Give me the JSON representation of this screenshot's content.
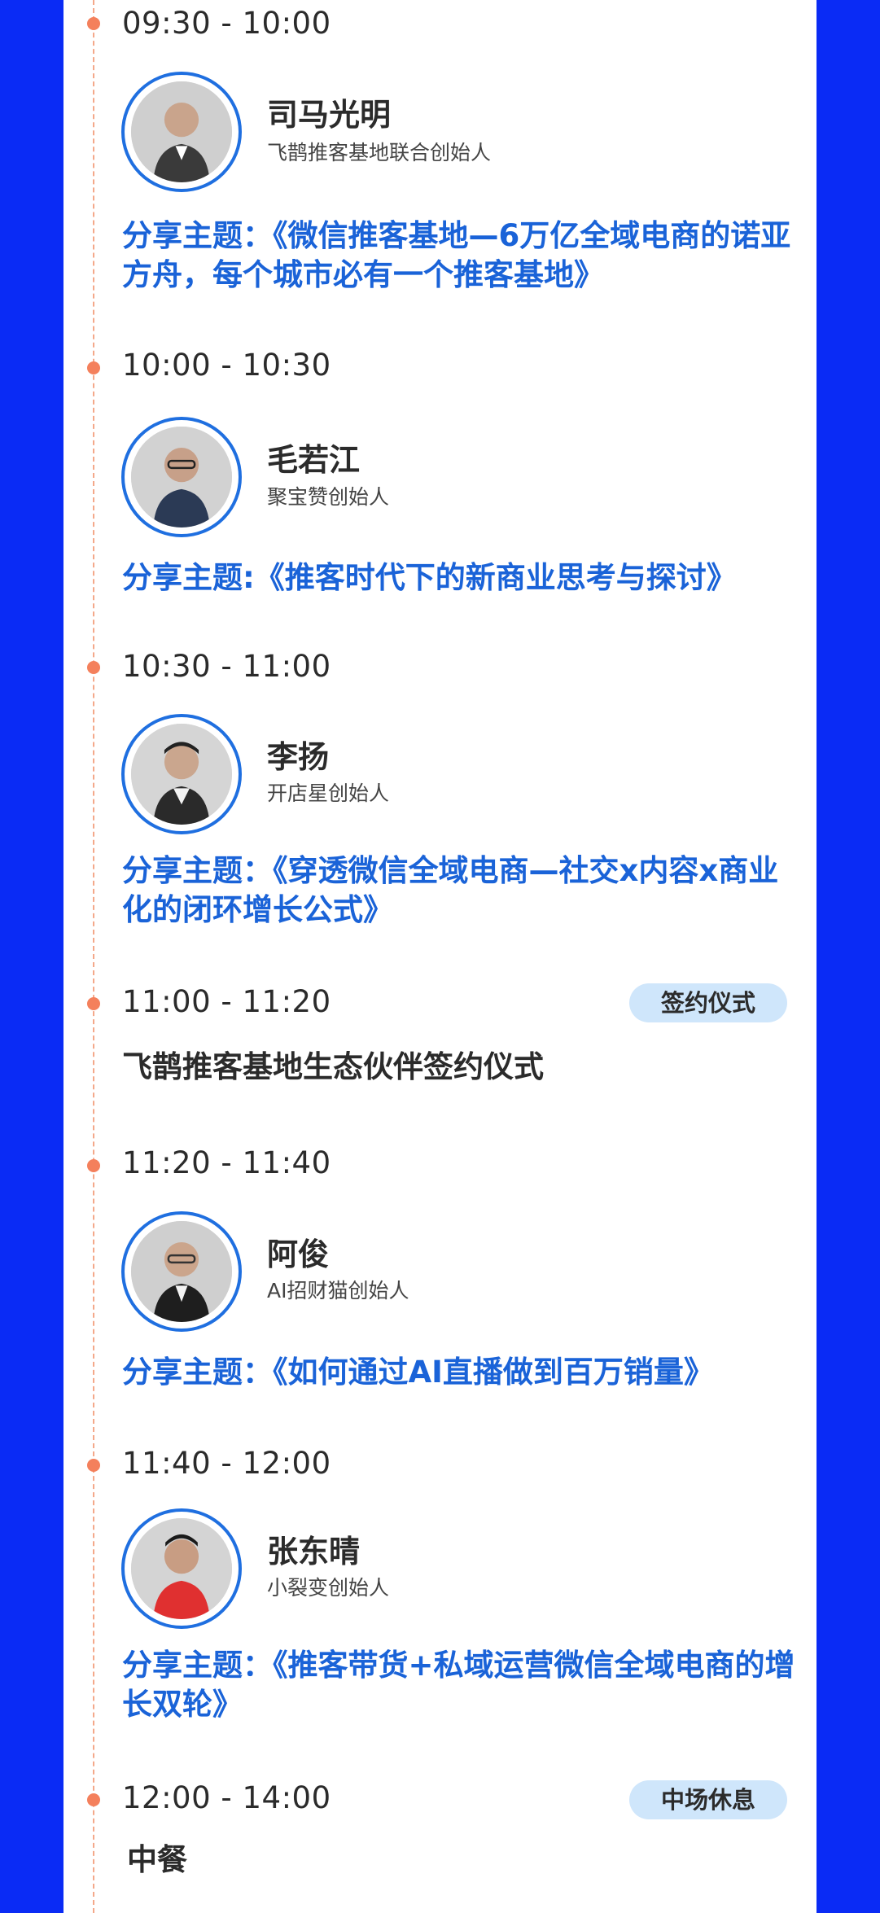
{
  "colors": {
    "background": "#0a2bf5",
    "card": "#ffffff",
    "timeline_dot": "#f4805c",
    "topic_text": "#1a63d8",
    "avatar_ring": "#1f6fe0",
    "badge_bg": "#cfe6fb"
  },
  "agenda": [
    {
      "time": "09:30 - 10:00",
      "speaker": {
        "name": "司马光明",
        "title": "飞鹊推客基地联合创始人",
        "avatar": "avatar-photo-icon"
      },
      "topic": "分享主题：《微信推客基地—6万亿全域电商的诺亚方舟，每个城市必有一个推客基地》"
    },
    {
      "time": "10:00 - 10:30",
      "speaker": {
        "name": "毛若江",
        "title": "聚宝赞创始人",
        "avatar": "avatar-photo-icon"
      },
      "topic": "分享主题:《推客时代下的新商业思考与探讨》"
    },
    {
      "time": "10:30 - 11:00",
      "speaker": {
        "name": "李扬",
        "title": "开店星创始人",
        "avatar": "avatar-photo-icon"
      },
      "topic": "分享主题：《穿透微信全域电商—社交x内容x商业化的闭环增长公式》"
    },
    {
      "time": "11:00 - 11:20",
      "badge": "签约仪式",
      "event": "飞鹊推客基地生态伙伴签约仪式"
    },
    {
      "time": "11:20 - 11:40",
      "speaker": {
        "name": "阿俊",
        "title": "AI招财猫创始人",
        "avatar": "avatar-photo-icon"
      },
      "topic": "分享主题：《如何通过AI直播做到百万销量》"
    },
    {
      "time": "11:40 - 12:00",
      "speaker": {
        "name": "张东晴",
        "title": "小裂变创始人",
        "avatar": "avatar-photo-icon"
      },
      "topic": "分享主题：《推客带货+私域运营微信全域电商的增长双轮》"
    },
    {
      "time": "12:00 - 14:00",
      "badge": "中场休息",
      "event": "中餐"
    }
  ]
}
